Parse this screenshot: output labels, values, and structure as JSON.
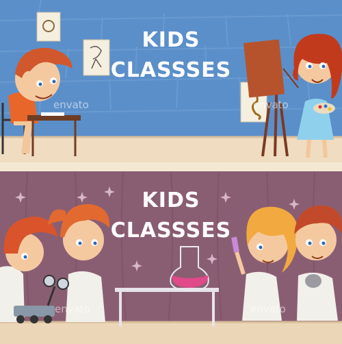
{
  "top_banner": {
    "title_line1": "KIDS",
    "title_line2": "CLASSSES",
    "watermark_left": "envato",
    "watermark_right": "envato",
    "wall_color": "#5b8fc9",
    "floor_color": "#f0dcc0"
  },
  "bottom_banner": {
    "title_line1": "KIDS",
    "title_line2": "CLASSSES",
    "watermark_left": "envato",
    "watermark_right": "envato",
    "wall_color": "#8a5e72",
    "floor_color": "#ecd6b8"
  },
  "icons": {
    "top_left_kid": "drawing-boy-icon",
    "top_right_kid": "painting-girl-icon",
    "bottom_left_kids": "robot-kids-icon",
    "bottom_center": "chemistry-flask-icon",
    "bottom_right_kids": "science-kids-icon"
  }
}
